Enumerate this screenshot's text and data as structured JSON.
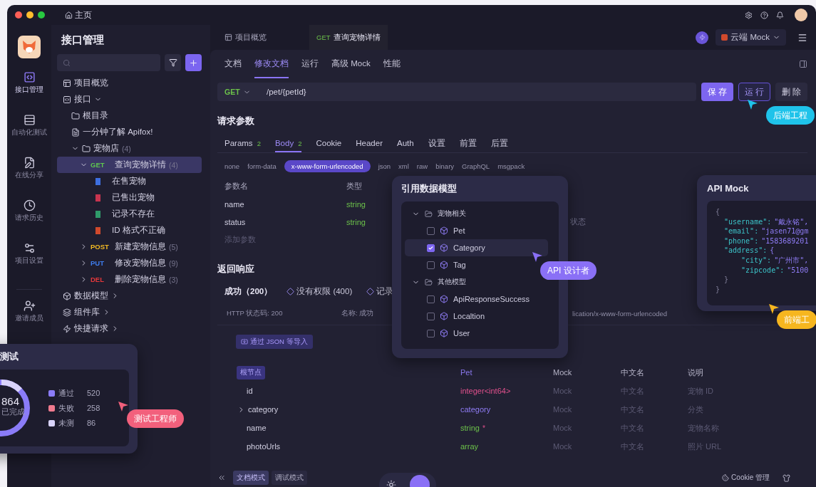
{
  "window": {
    "home": "主页"
  },
  "rail": [
    {
      "kind": "api",
      "label": "接口管理",
      "selected": true
    },
    {
      "kind": "auto",
      "label": "自动化测试",
      "selected": false
    },
    {
      "kind": "share",
      "label": "在线分享",
      "selected": false
    },
    {
      "kind": "history",
      "label": "请求历史",
      "selected": false
    },
    {
      "kind": "settings",
      "label": "项目设置",
      "selected": false
    },
    {
      "kind": "invite",
      "label": "邀请成员",
      "selected": false
    }
  ],
  "sidebar": {
    "title": "接口管理",
    "tree": [
      {
        "kind": "overview",
        "label": "项目概览",
        "selected": false
      },
      {
        "kind": "api",
        "label": "接口",
        "expanded": true,
        "selected": false,
        "children": [
          {
            "kind": "folder",
            "label": "根目录",
            "selected": false
          },
          {
            "kind": "doc",
            "label": "一分钟了解 Apifox!",
            "selected": false
          },
          {
            "kind": "folder",
            "label": "宠物店",
            "count": "(4)",
            "expanded": true,
            "selected": false,
            "children": [
              {
                "kind": "endpoint",
                "method": "GET",
                "color": "#5fc84f",
                "label": "查询宠物详情",
                "count": "(4)",
                "expanded": true,
                "selected": true,
                "children": [
                  {
                    "kind": "case",
                    "label": "在售宠物",
                    "color": "#3d6fe0",
                    "selected": false
                  },
                  {
                    "kind": "case",
                    "label": "已售出宠物",
                    "color": "#c8344f",
                    "selected": false
                  },
                  {
                    "kind": "case",
                    "label": "记录不存在",
                    "color": "#2f9a6a",
                    "selected": false
                  },
                  {
                    "kind": "case",
                    "label": "ID 格式不正确",
                    "color": "#d0492c",
                    "selected": false
                  }
                ]
              },
              {
                "kind": "endpoint",
                "method": "POST",
                "color": "#f2b924",
                "label": "新建宠物信息",
                "count": "(5)",
                "expanded": false,
                "selected": false
              },
              {
                "kind": "endpoint",
                "method": "PUT",
                "color": "#3f7ef0",
                "label": "修改宠物信息",
                "count": "(9)",
                "expanded": false,
                "selected": false
              },
              {
                "kind": "endpoint",
                "method": "DEL",
                "color": "#e5383b",
                "label": "删除宠物信息",
                "count": "(3)",
                "expanded": false,
                "selected": false
              }
            ]
          }
        ]
      },
      {
        "kind": "models",
        "label": "数据模型",
        "expanded": false,
        "selected": false
      },
      {
        "kind": "components",
        "label": "组件库",
        "expanded": false,
        "selected": false
      },
      {
        "kind": "quick",
        "label": "快捷请求",
        "expanded": false,
        "selected": false
      }
    ]
  },
  "tabs": [
    {
      "kind": "overview",
      "label": "项目概览",
      "selected": false
    },
    {
      "kind": "request",
      "method": "GET",
      "label": "查询宠物详情",
      "selected": true
    }
  ],
  "mock_env": {
    "label": "云端 Mock"
  },
  "doc_tabs": [
    {
      "label": "文档",
      "selected": false
    },
    {
      "label": "修改文档",
      "selected": true
    },
    {
      "label": "运行",
      "selected": false
    },
    {
      "label": "高级 Mock",
      "selected": false
    },
    {
      "label": "性能",
      "selected": false
    }
  ],
  "url": {
    "method": "GET",
    "path": "/pet/{petId}"
  },
  "actions": [
    {
      "kind": "primary",
      "label": "保存"
    },
    {
      "kind": "outline",
      "label": "运行"
    },
    {
      "kind": "plain",
      "label": "删除"
    }
  ],
  "request": {
    "title": "请求参数",
    "tabs": [
      {
        "label": "Params",
        "count": "2",
        "selected": false
      },
      {
        "label": "Body",
        "count": "2",
        "selected": true
      },
      {
        "label": "Cookie",
        "selected": false
      },
      {
        "label": "Header",
        "selected": false
      },
      {
        "label": "Auth",
        "selected": false
      },
      {
        "label": "设置",
        "selected": false
      },
      {
        "label": "前置",
        "selected": false
      },
      {
        "label": "后置",
        "selected": false
      }
    ],
    "body_types": [
      {
        "label": "none",
        "selected": false
      },
      {
        "label": "form-data",
        "selected": false
      },
      {
        "label": "x-www-form-urlencoded",
        "selected": true
      },
      {
        "label": "json",
        "selected": false
      },
      {
        "label": "xml",
        "selected": false
      },
      {
        "label": "raw",
        "selected": false
      },
      {
        "label": "binary",
        "selected": false
      },
      {
        "label": "GraphQL",
        "selected": false
      },
      {
        "label": "msgpack",
        "selected": false
      }
    ],
    "columns": [
      "参数名",
      "类型"
    ],
    "rows": [
      {
        "name": "name",
        "type": "string"
      },
      {
        "name": "status",
        "type": "string",
        "note": "状态"
      }
    ],
    "add": "添加参数"
  },
  "response": {
    "title": "返回响应",
    "tabs": [
      {
        "kind": "plain",
        "label": "成功（200）",
        "selected": true
      },
      {
        "kind": "diamond",
        "label": "没有权限 (400)",
        "selected": false
      },
      {
        "kind": "diamond",
        "label": "记录",
        "selected": false
      }
    ],
    "status_label": "HTTP 状态码:",
    "status": "200",
    "name_label": "名称:",
    "name": "成功",
    "content_type": "lication/x-www-form-urlencoded",
    "import": "通过 JSON 等导入"
  },
  "schema": {
    "root": "根节点",
    "columns": [
      "Pet",
      "Mock",
      "中文名",
      "说明"
    ],
    "rows": [
      {
        "name": "id",
        "type": "integer<int64>",
        "color": "#e0508c",
        "mock": "Mock",
        "cn": "中文名",
        "desc": "宠物 ID"
      },
      {
        "name": "category",
        "expanded": false,
        "type": "category",
        "color": "#8f7cf5",
        "mock": "Mock",
        "cn": "中文名",
        "desc": "分类"
      },
      {
        "name": "name",
        "type": "string",
        "required": "*",
        "color": "#6cc24a",
        "mock": "Mock",
        "cn": "中文名",
        "desc": "宠物名称"
      },
      {
        "name": "photoUrls",
        "type": "array",
        "color": "#6cc24a",
        "mock": "Mock",
        "cn": "中文名",
        "desc": "照片 URL"
      }
    ]
  },
  "theme_toggle": {
    "dark": true
  },
  "bottom": {
    "tabs": [
      {
        "label": "文档模式",
        "selected": true
      },
      {
        "label": "调试模式",
        "selected": false
      }
    ],
    "cookie": "Cookie 管理"
  },
  "models_card": {
    "title": "引用数据模型",
    "groups": [
      {
        "label": "宠物相关",
        "expanded": true,
        "items": [
          {
            "label": "Pet",
            "checked": false,
            "selected": false
          },
          {
            "label": "Category",
            "checked": true,
            "selected": true
          },
          {
            "label": "Tag",
            "checked": false,
            "selected": false
          }
        ]
      },
      {
        "label": "其他模型",
        "expanded": true,
        "items": [
          {
            "label": "ApiResponseSuccess",
            "checked": false,
            "selected": false
          },
          {
            "label": "Localtion",
            "checked": false,
            "selected": false
          },
          {
            "label": "User",
            "checked": false,
            "selected": false
          }
        ]
      }
    ]
  },
  "mock_card": {
    "title": "API Mock",
    "open": "{",
    "close": "}",
    "entries": [
      {
        "key": "\"username\":",
        "value": "\"戴永铭\","
      },
      {
        "key": "\"email\":",
        "value": "\"jasen71@gm"
      },
      {
        "key": "\"phone\":",
        "value": "\"1583689201"
      },
      {
        "key": "\"address\":",
        "value": "{",
        "close": "}",
        "children": [
          {
            "key": "\"city\":",
            "value": "\"广州市\","
          },
          {
            "key": "\"zipcode\":",
            "value": "\"5100"
          }
        ]
      }
    ]
  },
  "test_card": {
    "title": "测试",
    "total": "864",
    "total_label": "已完成",
    "legend": [
      {
        "label": "通过",
        "count": "520",
        "color": "#8b7cf8"
      },
      {
        "label": "失败",
        "count": "258",
        "color": "#f07a8e"
      },
      {
        "label": "未测",
        "count": "86",
        "color": "#d9d3fa"
      }
    ]
  },
  "badges": [
    {
      "label": "后端工程",
      "color": "#1fc3ea"
    },
    {
      "label": "API 设计者",
      "color": "#8a70f6"
    },
    {
      "label": "前端工",
      "color": "#f6b61f"
    },
    {
      "label": "测试工程师",
      "color": "#f2607c"
    }
  ]
}
